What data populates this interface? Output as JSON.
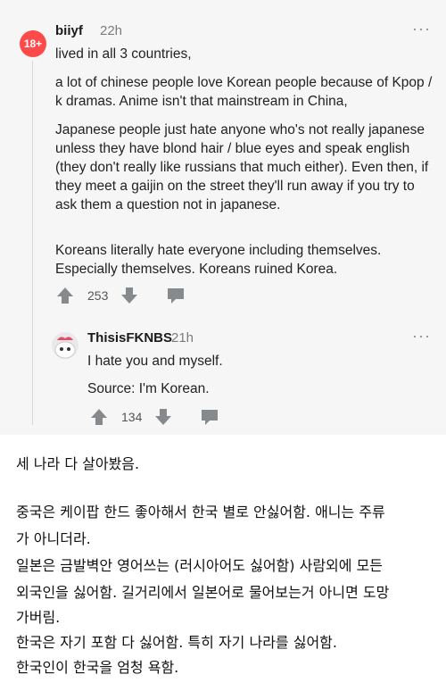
{
  "comment1": {
    "avatar_badge": "18+",
    "username": "biiyf",
    "time": "22h",
    "menu": "···",
    "paragraphs": [
      "lived in all 3 countries,",
      "a lot of chinese people love Korean people because of Kpop / k dramas. Anime isn't that mainstream in China,",
      "Japanese people just hate anyone who's not really japanese unless they have blond hair / blue eyes and speak english (they don't really like russians that much either). Even then, if they meet a gaijin on the street they'll run away if you try to ask them a question not in japanese.",
      "Koreans literally hate everyone including themselves. Especially themselves. Koreans ruined Korea."
    ],
    "votes": "253"
  },
  "reply": {
    "username": "ThisisFKNBS",
    "time": "21h",
    "menu": "···",
    "paragraphs": [
      "I hate you and myself.",
      "Source: I'm Korean."
    ],
    "votes": "134"
  },
  "translation": {
    "lines": [
      "세 나라 다 살아봤음.",
      " 중국은 케이팝 한드 좋아해서 한국 별로 안싫어함. 애니는 주류",
      "가 아니더라.",
      " 일본은 금발벽안 영어쓰는 (러시아어도 싫어함) 사람외에 모든",
      "외국인을 싫어함. 길거리에서 일본어로 물어보는거 아니면 도망",
      "가버림.",
      " 한국은 자기 포함 다 싫어함. 특히 자기 나라를 싫어함.",
      "한국인이 한국을 엄청 욕함."
    ]
  },
  "colors": {
    "screenshot_bg": "#f6f6f6",
    "nsfw_avatar": "#ff4a4a",
    "icon_gray": "#878a8c"
  }
}
